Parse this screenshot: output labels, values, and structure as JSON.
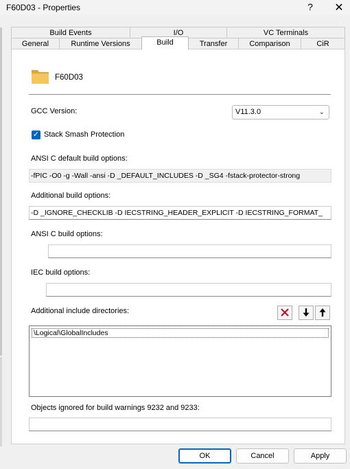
{
  "window": {
    "title": "F60D03 - Properties",
    "help_glyph": "?",
    "close_glyph": "✕"
  },
  "tabs": {
    "row1": [
      {
        "label": "Build Events"
      },
      {
        "label": "I/O"
      },
      {
        "label": "VC Terminals"
      }
    ],
    "row2": [
      {
        "label": "General"
      },
      {
        "label": "Runtime Versions"
      },
      {
        "label": "Build"
      },
      {
        "label": "Transfer"
      },
      {
        "label": "Comparison"
      },
      {
        "label": "CiR"
      }
    ],
    "active": "Build"
  },
  "object": {
    "name": "F60D03",
    "icon": "folder-icon"
  },
  "gcc": {
    "label": "GCC Version:",
    "value": "V11.3.0"
  },
  "stack_smash": {
    "label": "Stack Smash Protection",
    "checked": true
  },
  "ansi_default": {
    "label": "ANSI C default build options:",
    "value": "-fPIC -O0 -g -Wall -ansi -D _DEFAULT_INCLUDES -D _SG4 -fstack-protector-strong"
  },
  "additional_build": {
    "label": "Additional build options:",
    "value": "-D _IGNORE_CHECKLIB -D IECSTRING_HEADER_EXPLICIT -D IECSTRING_FORMAT_"
  },
  "ansi_build": {
    "label": "ANSI C build options:",
    "value": ""
  },
  "iec_build": {
    "label": "IEC build options:",
    "value": ""
  },
  "include_dirs": {
    "label": "Additional include directories:",
    "items": [
      "\\Logical\\GlobalIncludes"
    ],
    "delete_icon": "delete-x-icon",
    "down_icon": "arrow-down-icon",
    "up_icon": "arrow-up-icon"
  },
  "ignored": {
    "label": "Objects ignored for build warnings 9232 and 9233:",
    "value": ""
  },
  "buttons": {
    "ok": "OK",
    "cancel": "Cancel",
    "apply": "Apply"
  }
}
